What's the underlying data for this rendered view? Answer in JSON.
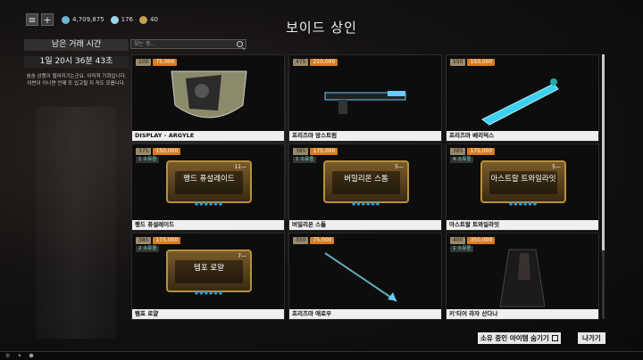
{
  "header": {
    "title": "보이드 상인"
  },
  "topbar": {
    "credits": "4,709,875",
    "platinum": "176",
    "ducats": "40"
  },
  "left_panel": {
    "heading": "남은 거래 시간",
    "timer": "1일 20시 36분 43초",
    "message": "숨숨 상품이 떨어지기는군요. 아직적 기회입니다. 이번이 아니면 언제 또 입고될 지 저도 모릅니다."
  },
  "search": {
    "placeholder": "찾는 중..."
  },
  "items": [
    {
      "name": "DISPLAY - ARGYLE",
      "ducats": "100",
      "credits": "75,000",
      "owned": "",
      "mod": ""
    },
    {
      "name": "프리즈마 앙스트럼",
      "ducats": "475",
      "credits": "210,000",
      "owned": "",
      "mod": ""
    },
    {
      "name": "프리즈마 베리덕스",
      "ducats": "550",
      "credits": "150,000",
      "owned": "",
      "mod": ""
    },
    {
      "name": "팽드 퓨설레이드",
      "ducats": "375",
      "credits": "150,000",
      "owned": "1 소유중",
      "mod": "팽드 퓨설레이드",
      "rank": "11"
    },
    {
      "name": "버밀리온 스톰",
      "ducats": "385",
      "credits": "175,000",
      "owned": "1 소유중",
      "mod": "버밀리온 스톰",
      "rank": "5"
    },
    {
      "name": "아스트랄 트와일라잇",
      "ducats": "385",
      "credits": "175,000",
      "owned": "4 소유중",
      "mod": "아스트랄 트와일라잇",
      "rank": "5"
    },
    {
      "name": "템포 로얄",
      "ducats": "385",
      "credits": "175,000",
      "owned": "2 소유중",
      "mod": "템포 로얄",
      "rank": "7"
    },
    {
      "name": "프리즈마 애로우",
      "ducats": "350",
      "credits": "75,000",
      "owned": "",
      "mod": ""
    },
    {
      "name": "키'티어 라자 산다나",
      "ducats": "400",
      "credits": "350,000",
      "owned": "1 소유중",
      "mod": ""
    }
  ],
  "bottom": {
    "hide_owned": "소유 중인 아이템 숨기기",
    "leave": "나가기"
  }
}
